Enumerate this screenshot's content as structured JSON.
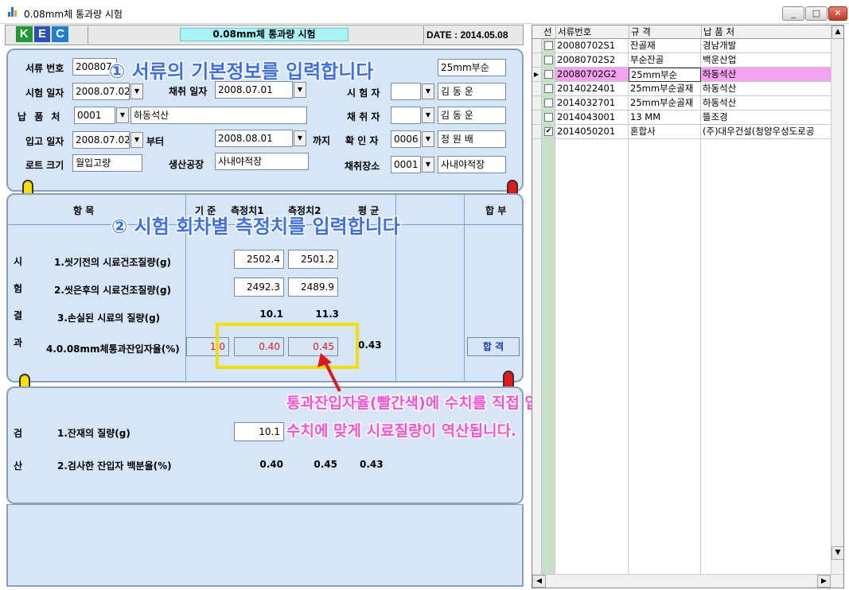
{
  "window": {
    "title": "0.08mm체 통과량 시험",
    "minimize": "_",
    "maximize": "□",
    "close": "✕"
  },
  "header": {
    "logo": [
      "K",
      "E",
      "C"
    ],
    "logo_colors": [
      "#1f9a2e",
      "#2a4fb8",
      "#1f7fc8"
    ],
    "title": "0.08mm체 통과량 시험",
    "date": "DATE : 2014.05.08"
  },
  "info": {
    "doc_no_label": "서류 번호",
    "doc_no": "200807",
    "spec": "25mm부순",
    "test_date_label": "시험 일자",
    "test_date": "2008.07.02",
    "sample_date_label": "채취 일자",
    "sample_date": "2008.07.01",
    "tester_label": "시 험 자",
    "tester": "김 동 운",
    "supplier_label": "납 품 처",
    "supplier_code": "0001",
    "supplier": "하동석산",
    "collector_label": "채 취 자",
    "collector": "김 동 운",
    "inbound_label": "입고 일자",
    "inbound_from": "2008.07.02",
    "from_suffix": "부터",
    "inbound_to": "2008.08.01",
    "to_suffix": "까지",
    "confirmer_label": "확 인 자",
    "confirmer_code": "0006",
    "confirmer": "정 원 배",
    "lot_label": "로트 크기",
    "lot": "월입고량",
    "plant_label": "생산공장",
    "plant": "사내야적장",
    "place_label": "채취장소",
    "place_code": "0001",
    "place": "사내야적장"
  },
  "results": {
    "col_item": "항      목",
    "col_std": "기 준",
    "col_m1": "측정치1",
    "col_m2": "측정치2",
    "col_avg": "평 균",
    "col_pass": "합 부",
    "side": [
      "시",
      "험",
      "결",
      "과"
    ],
    "rows": [
      {
        "label": "1.씻기전의 시료건조질량(g)",
        "m1": "2502.4",
        "m2": "2501.2"
      },
      {
        "label": "2.씻은후의 시료건조질량(g)",
        "m1": "2492.3",
        "m2": "2489.9"
      },
      {
        "label": "3.손실된 시료의 질량(g)",
        "m1": "10.1",
        "m2": "11.3"
      },
      {
        "label": "4.0.08mm체통과잔입자율(%)",
        "std": "1.0",
        "m1": "0.40",
        "m2": "0.45",
        "avg": "0.43",
        "pass": "합 격"
      }
    ]
  },
  "verify": {
    "side": [
      "검",
      "산"
    ],
    "rows": [
      {
        "label": "1.잔재의 질량(g)",
        "m1": "10.1"
      },
      {
        "label": "2.검사한 잔입자 백분율(%)",
        "m1": "0.40",
        "m2": "0.45",
        "avg": "0.43"
      }
    ]
  },
  "annotations": {
    "a1": "① 서류의 기본정보를 입력합니다",
    "a2": "② 시험 회차별 측정치를 입력합니다",
    "a3_line1": "통과잔입자율(빨간색)에 수치를 직접 입력하실 경우",
    "a3_line2": "수치에 맞게 시료질량이 역산됩니다.",
    "highlight_color": "#f0e000",
    "arrow_color": "#e01818"
  },
  "grid": {
    "headers": [
      "선",
      "서류번호",
      "규 격",
      "납 품 처"
    ],
    "rows": [
      {
        "checked": false,
        "no": "20080702S1",
        "spec": "잔골재",
        "supplier": "경남개발"
      },
      {
        "checked": false,
        "no": "20080702S2",
        "spec": "부순잔골",
        "supplier": "백운산업"
      },
      {
        "checked": false,
        "no": "20080702G2",
        "spec": "25mm부순",
        "supplier": "하동석산",
        "selected": true
      },
      {
        "checked": false,
        "no": "2014022401",
        "spec": "25mm부순골재",
        "supplier": "하동석산"
      },
      {
        "checked": false,
        "no": "2014032701",
        "spec": "25mm부순골재",
        "supplier": "하동석산"
      },
      {
        "checked": false,
        "no": "2014043001",
        "spec": "13 MM",
        "supplier": "뜰조경"
      },
      {
        "checked": true,
        "no": "2014050201",
        "spec": "혼합사",
        "supplier": "(주)대우건설(청양우성도로공"
      }
    ]
  }
}
